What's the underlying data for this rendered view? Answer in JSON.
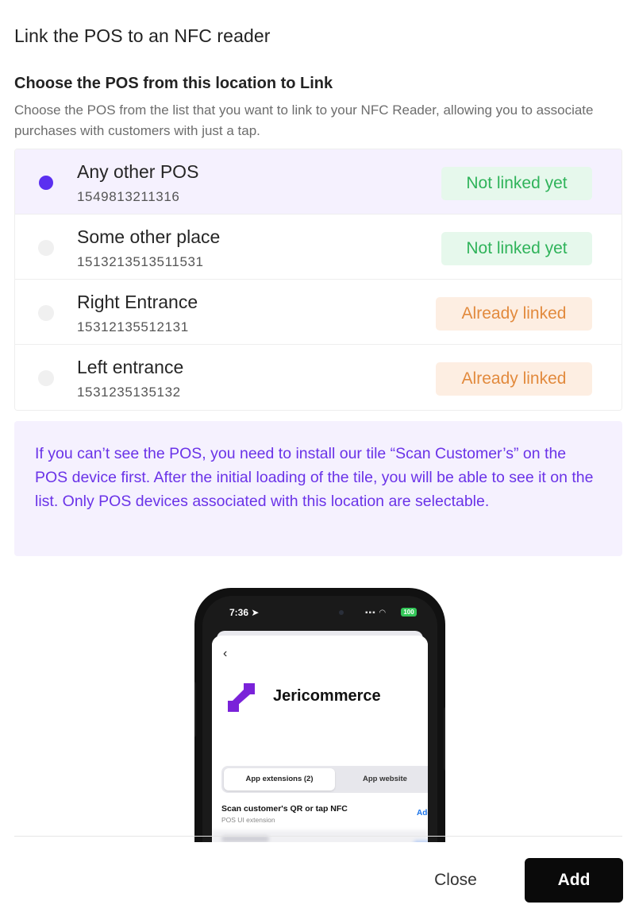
{
  "modal": {
    "title": "Link the POS to an NFC reader"
  },
  "section": {
    "title": "Choose the POS from this location to Link",
    "description": "Choose the POS from the list that you want to link to your NFC Reader, allowing you to associate purchases with customers with just a tap."
  },
  "pos_list": [
    {
      "name": "Any other POS",
      "id": "1549813211316",
      "status": "Not linked yet",
      "selected": true
    },
    {
      "name": "Some other place",
      "id": "1513213513511531",
      "status": "Not linked yet",
      "selected": false
    },
    {
      "name": "Right Entrance",
      "id": "15312135512131",
      "status": "Already linked",
      "selected": false
    },
    {
      "name": "Left entrance",
      "id": "1531235135132",
      "status": "Already linked",
      "selected": false
    }
  ],
  "info": {
    "text": "If you can’t see the POS, you need to install our tile “Scan Customer’s” on the POS device first. After the initial loading of the tile, you will be able to see it on the list. Only POS devices associated with this location are selectable."
  },
  "phone": {
    "time": "7:36",
    "battery": "100",
    "back_glyph": "‹",
    "app_name": "Jericommerce",
    "tabs": [
      "App extensions (2)",
      "App website"
    ],
    "extension_title": "Scan customer's QR or tap NFC",
    "extension_subtitle": "POS UI extension",
    "add_label": "Add"
  },
  "footer": {
    "close_label": "Close",
    "add_label": "Add"
  },
  "colors": {
    "accent": "#5b2ff0",
    "info_text": "#6a33e8",
    "info_bg": "#f5f1fe",
    "not_linked_bg": "#e6f8ec",
    "not_linked_text": "#2fb35a",
    "linked_bg": "#fdeee2",
    "linked_text": "#e28a3d",
    "primary_button": "#0a0a0a"
  },
  "icons": {
    "radio_selected": "radio-selected-icon",
    "radio_unselected": "radio-unselected-icon",
    "location_arrow": "location-arrow-icon",
    "back": "chevron-left-icon",
    "app_logo": "jericommerce-logo-icon"
  }
}
